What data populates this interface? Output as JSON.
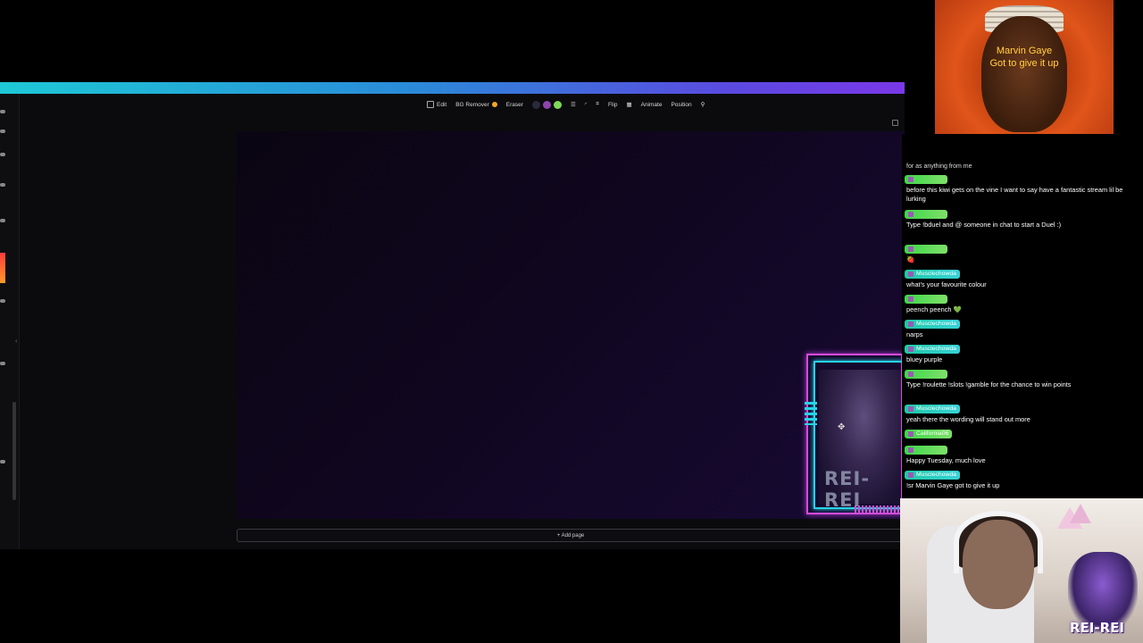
{
  "toolbar": {
    "edit": "Edit",
    "bg_remover": "BG Remover",
    "eraser": "Eraser",
    "flip": "Flip",
    "animate": "Animate",
    "position": "Position",
    "swatches": [
      "#2a2a3a",
      "#8e44ad",
      "#7ed957"
    ]
  },
  "canvas": {
    "add_page_label": "+ Add page",
    "frame_logo_text": "REI-REI"
  },
  "chat": {
    "top_cut_text": "for as anything from me",
    "messages": [
      {
        "user": "",
        "text": "before this kiwi gets on the vine I want to say have a fantastic stream lil be lurking",
        "pill": "green"
      },
      {
        "user": "",
        "text": "Type !bduel and @ someone in chat to start a Duel :)",
        "pill": "green"
      },
      {
        "user": "",
        "text": "🍓",
        "pill": "green"
      },
      {
        "user": "Musclechowda",
        "text": "what's your favourite colour",
        "pill": "teal"
      },
      {
        "user": "",
        "text": "peench peench 💚",
        "pill": "green"
      },
      {
        "user": "Musclechowda",
        "text": "narps",
        "pill": "teal"
      },
      {
        "user": "Musclechowda",
        "text": "bluey purple",
        "pill": "teal"
      },
      {
        "user": "",
        "text": "Type !roulette !slots !gamble for the chance to win points",
        "pill": "green"
      },
      {
        "user": "Musclechowda",
        "text": "yeah there the wording will stand out more",
        "pill": "teal"
      },
      {
        "user": "California06",
        "text": "",
        "pill": "green"
      },
      {
        "user": "",
        "text": "Happy Tuesday, much love",
        "pill": "green"
      },
      {
        "user": "Musclechowda",
        "text": "!sr Marvin Gaye got to give it up",
        "pill": "teal"
      }
    ]
  },
  "top_cam": {
    "caption_line1": "Marvin Gaye",
    "caption_line2": "Got to give it up"
  },
  "bottom_cam": {
    "logo_text": "REI-REI"
  }
}
